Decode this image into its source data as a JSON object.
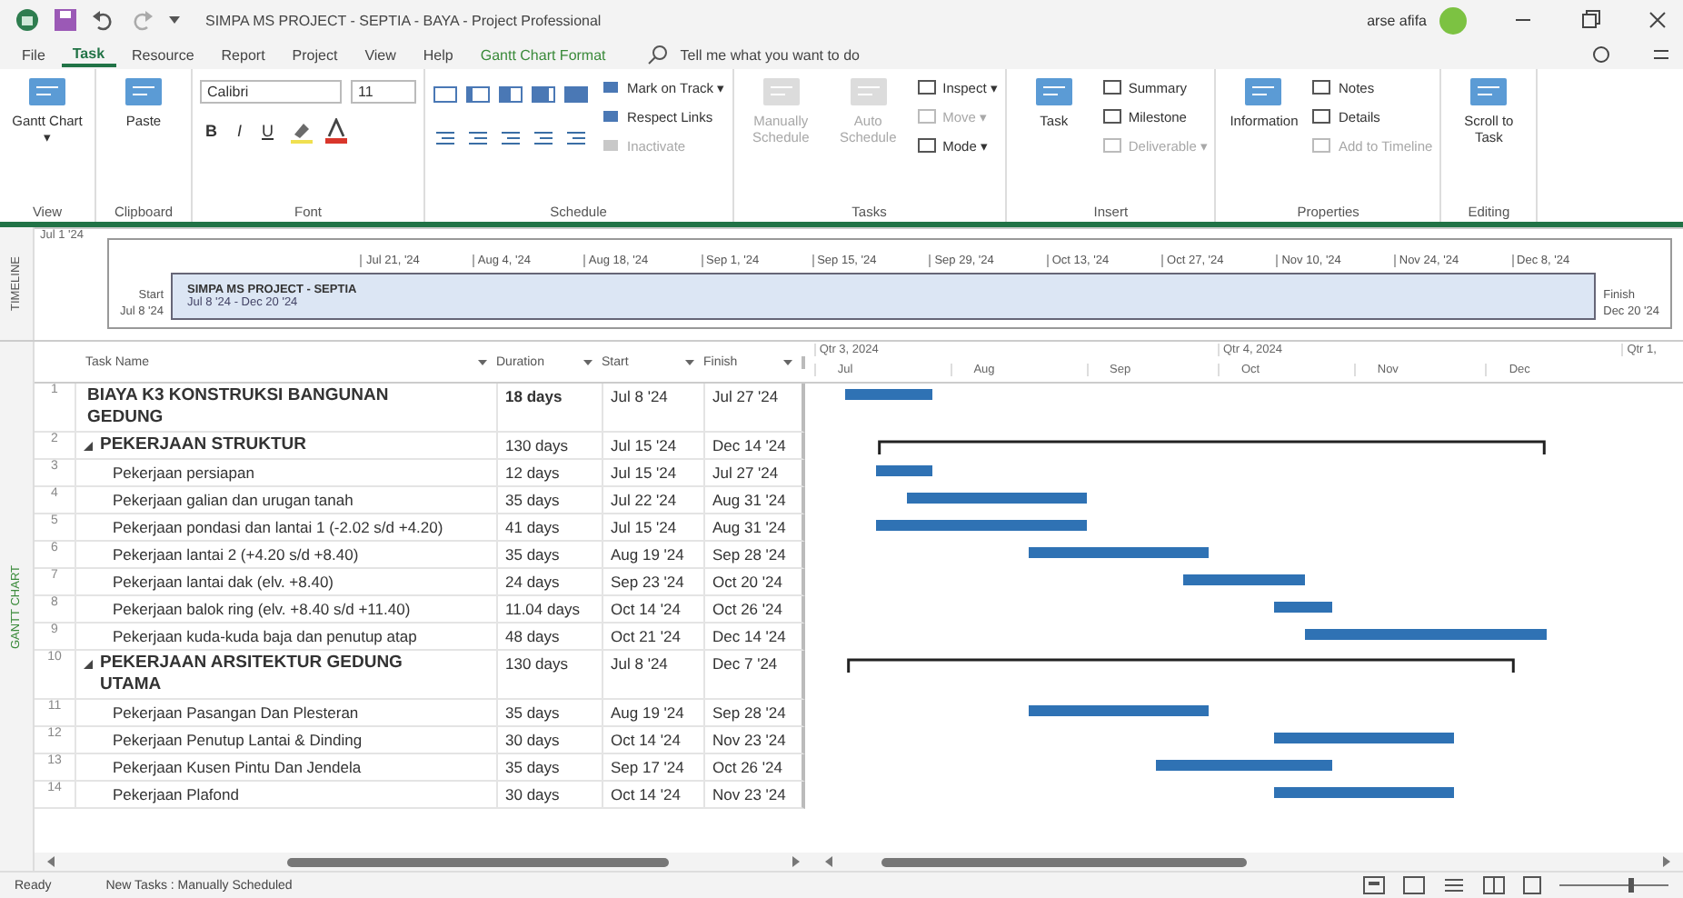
{
  "window": {
    "title": "SIMPA MS PROJECT - SEPTIA - BAYA - Project Professional",
    "user": "arse afifa"
  },
  "tabs": [
    {
      "label": "File",
      "selected": false,
      "kind": "plain"
    },
    {
      "label": "Task",
      "selected": true,
      "kind": "plain"
    },
    {
      "label": "Resource",
      "selected": false,
      "kind": "plain"
    },
    {
      "label": "Report",
      "selected": false,
      "kind": "plain"
    },
    {
      "label": "Project",
      "selected": false,
      "kind": "plain"
    },
    {
      "label": "View",
      "selected": false,
      "kind": "plain"
    },
    {
      "label": "Help",
      "selected": false,
      "kind": "plain"
    },
    {
      "label": "Gantt Chart Format",
      "selected": false,
      "kind": "context"
    }
  ],
  "tell_me": {
    "placeholder": "Tell me what you want to do"
  },
  "ribbon": [
    {
      "label": "View",
      "kind": "buttons",
      "large": [
        {
          "label": "Gantt Chart ▾",
          "disabled": false
        }
      ]
    },
    {
      "label": "Clipboard",
      "kind": "buttons",
      "large": [
        {
          "label": "Paste",
          "disabled": false
        }
      ]
    },
    {
      "label": "Font",
      "kind": "font",
      "font": "Calibri",
      "size": "11",
      "styles": [
        "B",
        "I",
        "U"
      ]
    },
    {
      "label": "Schedule",
      "kind": "schedule",
      "small": [
        {
          "label": "Mark on Track ▾",
          "disabled": false
        },
        {
          "label": "Respect Links",
          "disabled": false
        },
        {
          "label": "Inactivate",
          "disabled": true
        }
      ]
    },
    {
      "label": "Tasks",
      "kind": "buttons",
      "large": [
        {
          "label": "Manually Schedule",
          "disabled": true
        },
        {
          "label": "Auto Schedule",
          "disabled": true
        }
      ],
      "small": [
        {
          "label": "Inspect ▾",
          "disabled": false
        },
        {
          "label": "Move ▾",
          "disabled": true
        },
        {
          "label": "Mode ▾",
          "disabled": false
        }
      ]
    },
    {
      "label": "Insert",
      "kind": "buttons",
      "large": [
        {
          "label": "Task",
          "disabled": false
        }
      ],
      "small": [
        {
          "label": "Summary",
          "disabled": false
        },
        {
          "label": "Milestone",
          "disabled": false
        },
        {
          "label": "Deliverable ▾",
          "disabled": true
        }
      ]
    },
    {
      "label": "Properties",
      "kind": "buttons",
      "large": [
        {
          "label": "Information",
          "disabled": false
        }
      ],
      "small": [
        {
          "label": "Notes",
          "disabled": false
        },
        {
          "label": "Details",
          "disabled": false
        },
        {
          "label": "Add to Timeline",
          "disabled": true
        }
      ]
    },
    {
      "label": "Editing",
      "kind": "buttons",
      "large": [
        {
          "label": "Scroll to Task",
          "disabled": false
        }
      ]
    }
  ],
  "timeline": {
    "label": "TIMELINE",
    "start_label": "Start",
    "start_date": "Jul 8 '24",
    "finish_label": "Finish",
    "finish_date": "Dec 20 '24",
    "today": "Jul 1 '24",
    "ticks": [
      "Jul 21, '24",
      "Aug 4, '24",
      "Aug 18, '24",
      "Sep 1, '24",
      "Sep 15, '24",
      "Sep 29, '24",
      "Oct 13, '24",
      "Oct 27, '24",
      "Nov 10, '24",
      "Nov 24, '24",
      "Dec 8, '24"
    ],
    "bar": {
      "title": "SIMPA MS PROJECT - SEPTIA",
      "dates": "Jul 8 '24 - Dec 20 '24"
    }
  },
  "view_label": "GANTT CHART",
  "table": {
    "columns": [
      "Task Name",
      "Duration",
      "Start",
      "Finish"
    ],
    "rows": [
      {
        "id": "1",
        "name": "BIAYA K3 KONSTRUKSI BANGUNAN GEDUNG",
        "duration": "18 days",
        "start": "Jul 8 '24",
        "finish": "Jul 27 '24",
        "kind": "top"
      },
      {
        "id": "2",
        "name": "PEKERJAAN STRUKTUR",
        "duration": "130 days",
        "start": "Jul 15 '24",
        "finish": "Dec 14 '24",
        "kind": "summary",
        "expanded": true
      },
      {
        "id": "3",
        "name": "Pekerjaan persiapan",
        "duration": "12 days",
        "start": "Jul 15 '24",
        "finish": "Jul 27 '24",
        "kind": "task"
      },
      {
        "id": "4",
        "name": "Pekerjaan galian dan urugan tanah",
        "duration": "35 days",
        "start": "Jul 22 '24",
        "finish": "Aug 31 '24",
        "kind": "task"
      },
      {
        "id": "5",
        "name": "Pekerjaan pondasi dan lantai 1 (-2.02 s/d +4.20)",
        "duration": "41 days",
        "start": "Jul 15 '24",
        "finish": "Aug 31 '24",
        "kind": "task"
      },
      {
        "id": "6",
        "name": "Pekerjaan lantai 2 (+4.20 s/d +8.40)",
        "duration": "35 days",
        "start": "Aug 19 '24",
        "finish": "Sep 28 '24",
        "kind": "task"
      },
      {
        "id": "7",
        "name": "Pekerjaan lantai dak (elv. +8.40)",
        "duration": "24 days",
        "start": "Sep 23 '24",
        "finish": "Oct 20 '24",
        "kind": "task"
      },
      {
        "id": "8",
        "name": "Pekerjaan balok ring (elv. +8.40 s/d +11.40)",
        "duration": "11.04 days",
        "start": "Oct 14 '24",
        "finish": "Oct 26 '24",
        "kind": "task"
      },
      {
        "id": "9",
        "name": "Pekerjaan kuda-kuda baja dan penutup atap",
        "duration": "48 days",
        "start": "Oct 21 '24",
        "finish": "Dec 14 '24",
        "kind": "task"
      },
      {
        "id": "10",
        "name": "PEKERJAAN ARSITEKTUR GEDUNG UTAMA",
        "duration": "130 days",
        "start": "Jul 8 '24",
        "finish": "Dec 7 '24",
        "kind": "summary",
        "expanded": true
      },
      {
        "id": "11",
        "name": "Pekerjaan Pasangan Dan Plesteran",
        "duration": "35 days",
        "start": "Aug 19 '24",
        "finish": "Sep 28 '24",
        "kind": "task"
      },
      {
        "id": "12",
        "name": "Pekerjaan Penutup Lantai & Dinding",
        "duration": "30 days",
        "start": "Oct 14 '24",
        "finish": "Nov 23 '24",
        "kind": "task"
      },
      {
        "id": "13",
        "name": "Pekerjaan Kusen Pintu Dan Jendela",
        "duration": "35 days",
        "start": "Sep 17 '24",
        "finish": "Oct 26 '24",
        "kind": "task"
      },
      {
        "id": "14",
        "name": "Pekerjaan Plafond",
        "duration": "30 days",
        "start": "Oct 14 '24",
        "finish": "Nov 23 '24",
        "kind": "task"
      }
    ]
  },
  "timescale": {
    "quarters": [
      "Qtr 3, 2024",
      "Qtr 4, 2024",
      "Qtr 1,"
    ],
    "months": [
      "Jul",
      "Aug",
      "Sep",
      "Oct",
      "Nov",
      "Dec"
    ]
  },
  "status_bar": {
    "ready": "Ready",
    "mode": "New Tasks : Manually Scheduled"
  }
}
